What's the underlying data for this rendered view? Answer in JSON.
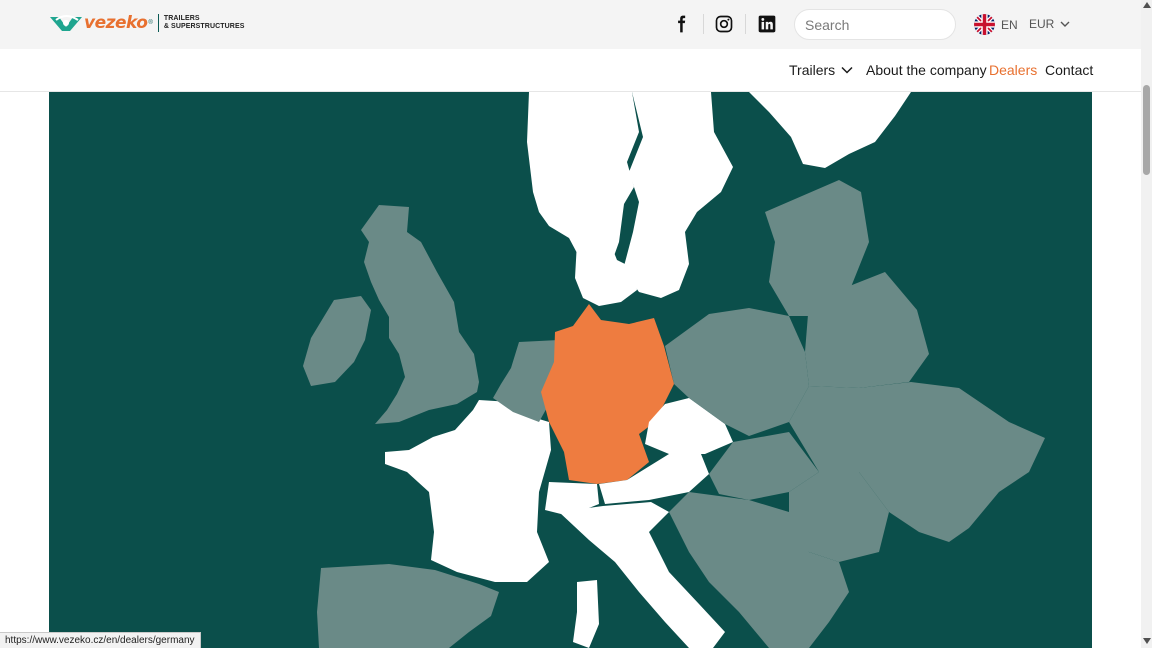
{
  "header": {
    "logo": {
      "brand": "vezeko",
      "registered": "®",
      "tagline_line1": "TRAILERS",
      "tagline_line2": "& SUPERSTRUCTURES"
    },
    "social": {
      "facebook_icon": "facebook-icon",
      "instagram_icon": "instagram-icon",
      "linkedin_icon": "linkedin-icon"
    },
    "search": {
      "placeholder": "Search",
      "value": ""
    },
    "language": {
      "label": "EN",
      "flag_icon": "uk-flag-icon"
    },
    "currency": {
      "label": "EUR",
      "chevron_icon": "chevron-down-icon"
    }
  },
  "nav": {
    "items": [
      {
        "label": "Trailers",
        "has_dropdown": true
      },
      {
        "label": "About the company"
      },
      {
        "label": "Dealers",
        "active": true
      },
      {
        "label": "Contact"
      }
    ]
  },
  "map": {
    "highlighted_country": "Germany",
    "colors": {
      "sea": "#0b4f4b",
      "highlighted": "#ee7c40",
      "dealer_country": "#ffffff",
      "other_country": "#6a8a87"
    }
  },
  "status_bar": {
    "url": "https://www.vezeko.cz/en/dealers/germany"
  },
  "colors": {
    "accent": "#e8702f",
    "brand_dark": "#0b5a54"
  }
}
